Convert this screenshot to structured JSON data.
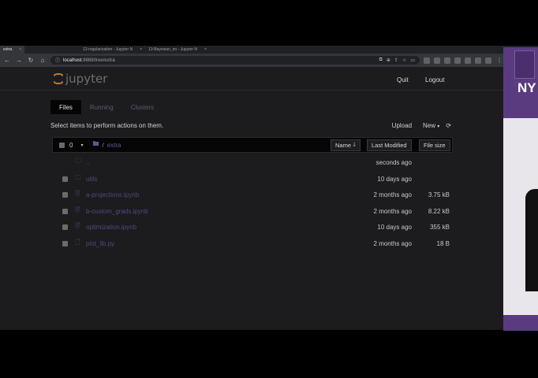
{
  "browser": {
    "tabs": [
      {
        "label": "extra",
        "active": true
      },
      {
        "label": "12-regularization - Jupyter N",
        "active": false
      },
      {
        "label": "13-Bayesian_nn - Jupyter N",
        "active": false
      }
    ],
    "url_host": "localhost",
    "url_path": ":8888/tree/extra"
  },
  "jupyter": {
    "logo_text": "jupyter",
    "quit_label": "Quit",
    "logout_label": "Logout",
    "tabs": [
      "Files",
      "Running",
      "Clusters"
    ],
    "instructions": "Select items to perform actions on them.",
    "upload_label": "Upload",
    "new_label": "New",
    "selected_count": "0",
    "breadcrumb_sep": "/",
    "current_dir": "extra",
    "columns": {
      "name": "Name",
      "modified": "Last Modified",
      "size": "File size"
    },
    "files": [
      {
        "name": "..",
        "type": "parent",
        "modified": "seconds ago",
        "size": ""
      },
      {
        "name": "utils",
        "type": "folder",
        "modified": "10 days ago",
        "size": ""
      },
      {
        "name": "a-projections.ipynb",
        "type": "notebook",
        "modified": "2 months ago",
        "size": "3.75 kB"
      },
      {
        "name": "b-custom_grads.ipynb",
        "type": "notebook",
        "modified": "2 months ago",
        "size": "8.22 kB"
      },
      {
        "name": "optimization.ipynb",
        "type": "notebook",
        "modified": "10 days ago",
        "size": "355 kB"
      },
      {
        "name": "plot_lib.py",
        "type": "file",
        "modified": "2 months ago",
        "size": "18 B"
      }
    ]
  },
  "side_panel": {
    "text": "NY"
  },
  "colors": {
    "accent": "#c77b2e",
    "link": "#4a4a80",
    "side": "#5a3b80"
  }
}
